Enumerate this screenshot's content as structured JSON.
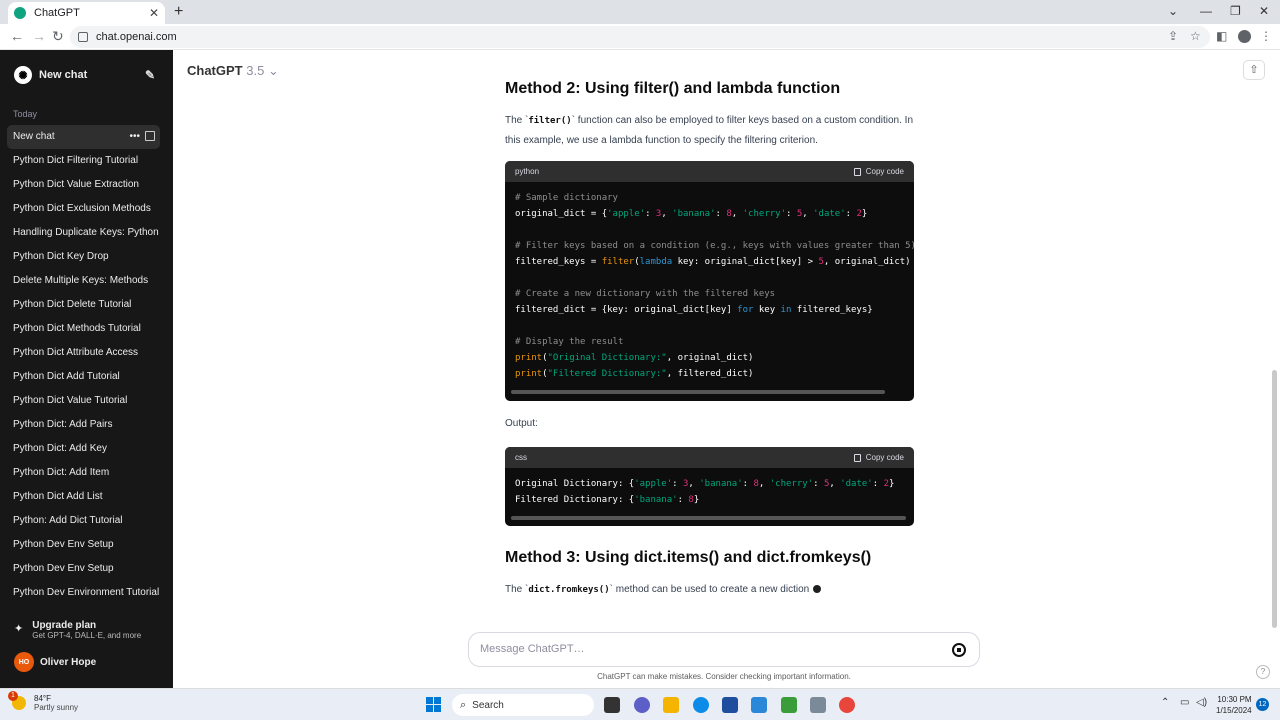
{
  "browser": {
    "tab_title": "ChatGPT",
    "url": "chat.openai.com"
  },
  "sidebar": {
    "new_chat": "New chat",
    "section": "Today",
    "items": [
      {
        "label": "New chat"
      },
      {
        "label": "Python Dict Filtering Tutorial"
      },
      {
        "label": "Python Dict Value Extraction"
      },
      {
        "label": "Python Dict Exclusion Methods"
      },
      {
        "label": "Handling Duplicate Keys: Python"
      },
      {
        "label": "Python Dict Key Drop"
      },
      {
        "label": "Delete Multiple Keys: Methods"
      },
      {
        "label": "Python Dict Delete Tutorial"
      },
      {
        "label": "Python Dict Methods Tutorial"
      },
      {
        "label": "Python Dict Attribute Access"
      },
      {
        "label": "Python Dict Add Tutorial"
      },
      {
        "label": "Python Dict Value Tutorial"
      },
      {
        "label": "Python Dict: Add Pairs"
      },
      {
        "label": "Python Dict: Add Key"
      },
      {
        "label": "Python Dict: Add Item"
      },
      {
        "label": "Python Dict Add List"
      },
      {
        "label": "Python: Add Dict Tutorial"
      },
      {
        "label": "Python Dev Env Setup"
      },
      {
        "label": "Python Dev Env Setup"
      },
      {
        "label": "Python Dev Environment Tutorial"
      }
    ],
    "upgrade_title": "Upgrade plan",
    "upgrade_sub": "Get GPT-4, DALL·E, and more",
    "user_initials": "HO",
    "user_name": "Oliver Hope"
  },
  "header": {
    "model": "ChatGPT",
    "version": "3.5"
  },
  "content": {
    "method2_heading": "Method 2: Using filter() and lambda function",
    "method2_text_pre": "The `",
    "method2_code": "filter()",
    "method2_text_post": "` function can also be employed to filter keys based on a custom condition. In this example, we use a lambda function to specify the filtering criterion.",
    "code1_lang": "python",
    "copy_label": "Copy code",
    "output_label": "Output:",
    "code2_lang": "css",
    "method3_heading": "Method 3: Using dict.items() and dict.fromkeys()",
    "method3_text_pre": "The `",
    "method3_code": "dict.fromkeys()",
    "method3_text_post": "` method can be used to create a new diction"
  },
  "composer": {
    "placeholder": "Message ChatGPT…",
    "disclaimer": "ChatGPT can make mistakes. Consider checking important information."
  },
  "taskbar": {
    "temp": "84°F",
    "weather": "Partly sunny",
    "weather_badge": "1",
    "search": "Search",
    "time": "10:30 PM",
    "date": "1/15/2024",
    "notif_count": "12"
  }
}
